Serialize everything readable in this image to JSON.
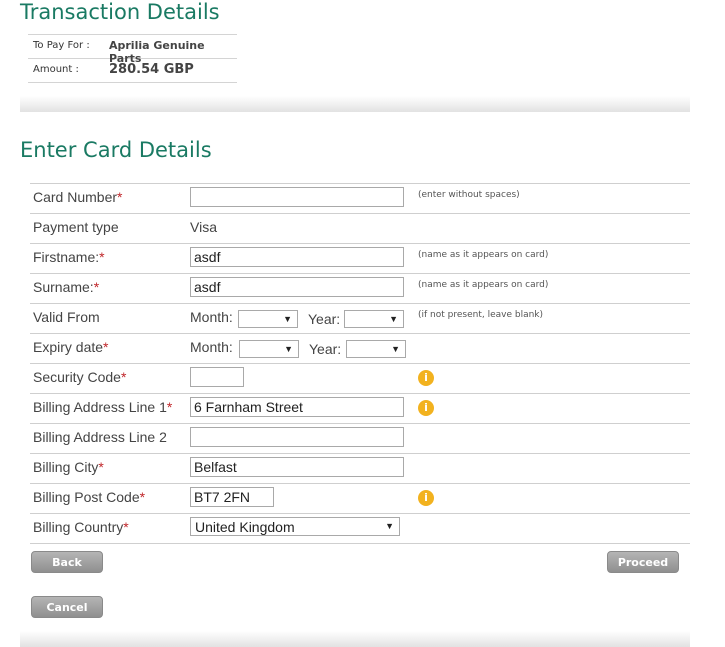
{
  "transaction": {
    "title": "Transaction Details",
    "to_pay_label": "To Pay For :",
    "to_pay_value": "Aprilia Genuine Parts",
    "amount_label": "Amount :",
    "amount_value": "280.54 GBP"
  },
  "card": {
    "title": "Enter Card Details",
    "card_number": {
      "label": "Card Number",
      "required": "*",
      "value": "",
      "hint": "(enter without spaces)"
    },
    "payment_type": {
      "label": "Payment type",
      "value": "Visa"
    },
    "firstname": {
      "label": "Firstname:",
      "required": "*",
      "value": "asdf",
      "hint": "(name as it appears on card)"
    },
    "surname": {
      "label": "Surname:",
      "required": "*",
      "value": "asdf",
      "hint": "(name as it appears on card)"
    },
    "valid_from": {
      "label": "Valid From",
      "month_label": "Month:",
      "month_value": "",
      "year_label": "Year:",
      "year_value": "",
      "hint": "(if not present, leave blank)"
    },
    "expiry": {
      "label": "Expiry date",
      "required": "*",
      "month_label": "Month:",
      "month_value": "",
      "year_label": "Year:",
      "year_value": ""
    },
    "security_code": {
      "label": "Security Code",
      "required": "*",
      "value": ""
    },
    "address1": {
      "label": "Billing Address Line 1",
      "required": "*",
      "value": "6 Farnham Street"
    },
    "address2": {
      "label": "Billing Address Line 2",
      "value": ""
    },
    "city": {
      "label": "Billing City",
      "required": "*",
      "value": "Belfast"
    },
    "postcode": {
      "label": "Billing Post Code",
      "required": "*",
      "value": "BT7 2FN"
    },
    "country": {
      "label": "Billing Country",
      "required": "*",
      "value": "United Kingdom"
    }
  },
  "info_icon_glyph": "i",
  "buttons": {
    "back": "Back",
    "proceed": "Proceed",
    "cancel": "Cancel"
  },
  "colors": {
    "heading": "#1a7a63",
    "required": "#c0262a",
    "info_icon": "#f2b21f",
    "button": "#9e9e9e"
  }
}
